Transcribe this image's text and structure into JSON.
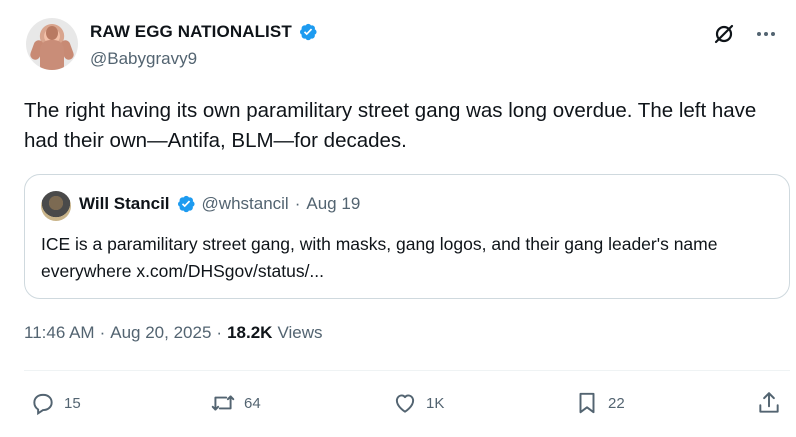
{
  "author": {
    "display_name": "RAW EGG NATIONALIST",
    "handle": "@Babygravy9",
    "avatar_icon": "bodybuilder-avatar"
  },
  "top_icons": [
    "grok-icon",
    "more-icon"
  ],
  "tweet": {
    "text": "The right having its own paramilitary street gang was long overdue. The left have had their own—Antifa, BLM—for decades."
  },
  "quote": {
    "display_name": "Will Stancil",
    "handle": "@whstancil",
    "separator": "·",
    "date": "Aug 19",
    "text": "ICE is a paramilitary street gang, with masks, gang logos, and their gang leader's name everywhere x.com/DHSgov/status/..."
  },
  "meta": {
    "time": "11:46 AM",
    "sep1": "·",
    "date": "Aug 20, 2025",
    "sep2": "·",
    "views_count": "18.2K",
    "views_label": "Views"
  },
  "actions": {
    "replies": "15",
    "reposts": "64",
    "likes": "1K",
    "bookmarks": "22"
  },
  "colors": {
    "verified": "#1d9bf0",
    "secondary_text": "#536471",
    "border": "#cfd9de"
  }
}
